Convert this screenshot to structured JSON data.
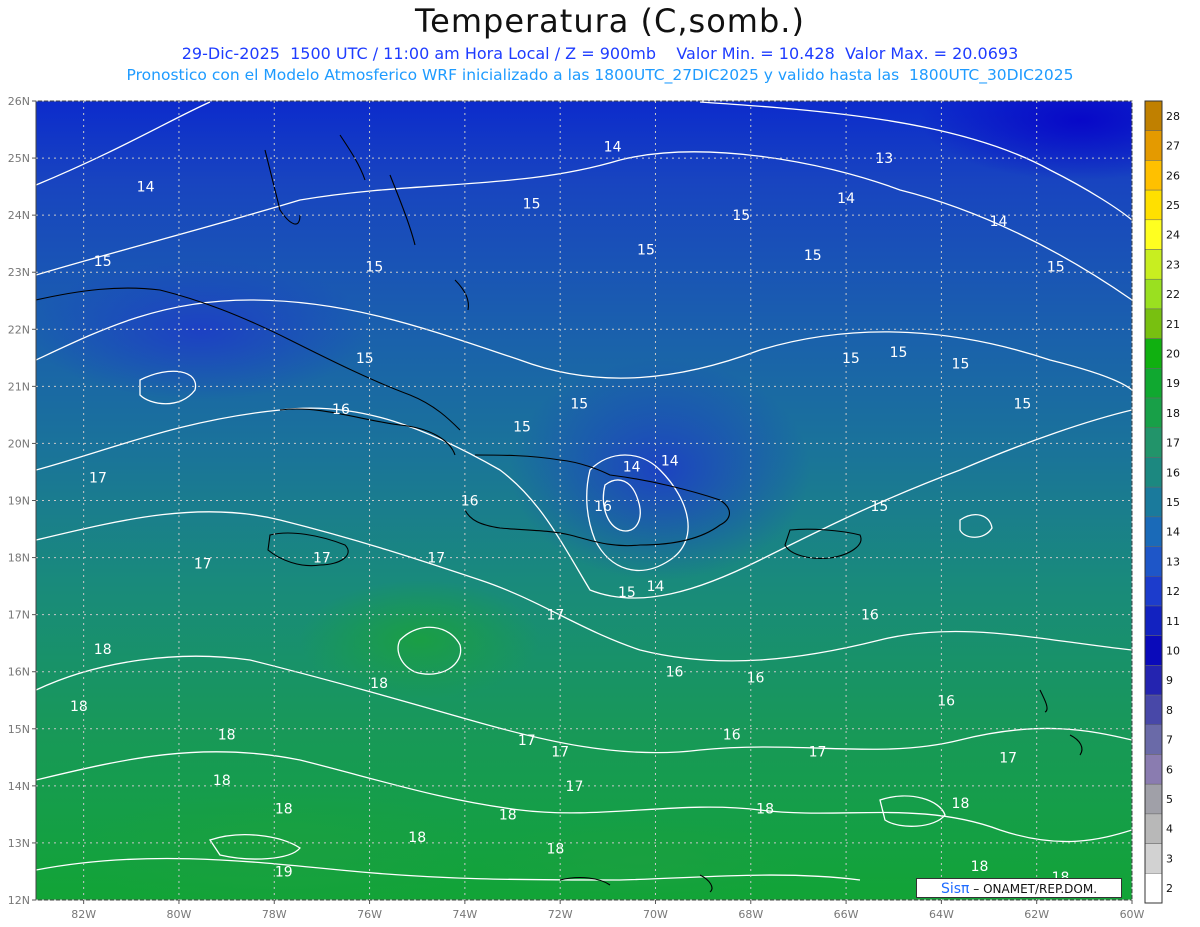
{
  "title": "Temperatura (C,somb.)",
  "subtitle_line1": "29-Dic-2025  1500 UTC / 11:00 am Hora Local / Z = 900mb    Valor Min. = 10.428  Valor Max. = 20.0693",
  "subtitle_line2": "Pronostico con el Modelo Atmosferico WRF inicializado a las 1800UTC_27DIC2025 y valido hasta las  1800UTC_30DIC2025",
  "credit": {
    "brand": "Sisπ",
    "text": "– ONAMET/REP.DOM."
  },
  "map": {
    "lon_range": [
      -83,
      -60
    ],
    "lat_range": [
      12,
      26
    ],
    "lon_ticks": [
      "82W",
      "80W",
      "78W",
      "76W",
      "74W",
      "72W",
      "70W",
      "68W",
      "66W",
      "64W",
      "62W",
      "60W"
    ],
    "lat_ticks": [
      "26N",
      "25N",
      "24N",
      "23N",
      "22N",
      "21N",
      "20N",
      "19N",
      "18N",
      "17N",
      "16N",
      "15N",
      "14N",
      "13N",
      "12N"
    ],
    "grid": true,
    "contour_labels": [
      {
        "text": "13",
        "lon": -65.2,
        "lat": 25.0
      },
      {
        "text": "14",
        "lon": -80.7,
        "lat": 24.5
      },
      {
        "text": "14",
        "lon": -70.9,
        "lat": 25.2
      },
      {
        "text": "14",
        "lon": -66.0,
        "lat": 24.3
      },
      {
        "text": "14",
        "lon": -62.8,
        "lat": 23.9
      },
      {
        "text": "15",
        "lon": -81.6,
        "lat": 23.2
      },
      {
        "text": "15",
        "lon": -72.6,
        "lat": 24.2
      },
      {
        "text": "15",
        "lon": -68.2,
        "lat": 24.0
      },
      {
        "text": "15",
        "lon": -70.2,
        "lat": 23.4
      },
      {
        "text": "15",
        "lon": -66.7,
        "lat": 23.3
      },
      {
        "text": "15",
        "lon": -75.9,
        "lat": 23.1
      },
      {
        "text": "15",
        "lon": -61.6,
        "lat": 23.1
      },
      {
        "text": "15",
        "lon": -76.1,
        "lat": 21.5
      },
      {
        "text": "15",
        "lon": -65.9,
        "lat": 21.5
      },
      {
        "text": "15",
        "lon": -64.9,
        "lat": 21.6
      },
      {
        "text": "15",
        "lon": -63.6,
        "lat": 21.4
      },
      {
        "text": "15",
        "lon": -62.3,
        "lat": 20.7
      },
      {
        "text": "15",
        "lon": -71.6,
        "lat": 20.7
      },
      {
        "text": "15",
        "lon": -72.8,
        "lat": 20.3
      },
      {
        "text": "16",
        "lon": -76.6,
        "lat": 20.6
      },
      {
        "text": "14",
        "lon": -70.5,
        "lat": 19.6
      },
      {
        "text": "14",
        "lon": -69.7,
        "lat": 19.7
      },
      {
        "text": "16",
        "lon": -73.9,
        "lat": 19.0
      },
      {
        "text": "16",
        "lon": -71.1,
        "lat": 18.9
      },
      {
        "text": "15",
        "lon": -65.3,
        "lat": 18.9
      },
      {
        "text": "17",
        "lon": -81.7,
        "lat": 19.4
      },
      {
        "text": "17",
        "lon": -79.5,
        "lat": 17.9
      },
      {
        "text": "17",
        "lon": -77.0,
        "lat": 18.0
      },
      {
        "text": "17",
        "lon": -74.6,
        "lat": 18.0
      },
      {
        "text": "15",
        "lon": -70.6,
        "lat": 17.4
      },
      {
        "text": "14",
        "lon": -70.0,
        "lat": 17.5
      },
      {
        "text": "17",
        "lon": -72.1,
        "lat": 17.0
      },
      {
        "text": "16",
        "lon": -65.5,
        "lat": 17.0
      },
      {
        "text": "18",
        "lon": -81.6,
        "lat": 16.4
      },
      {
        "text": "18",
        "lon": -75.8,
        "lat": 15.8
      },
      {
        "text": "16",
        "lon": -69.6,
        "lat": 16.0
      },
      {
        "text": "16",
        "lon": -67.9,
        "lat": 15.9
      },
      {
        "text": "16",
        "lon": -63.9,
        "lat": 15.5
      },
      {
        "text": "18",
        "lon": -82.1,
        "lat": 15.4
      },
      {
        "text": "18",
        "lon": -79.0,
        "lat": 14.9
      },
      {
        "text": "17",
        "lon": -72.7,
        "lat": 14.8
      },
      {
        "text": "17",
        "lon": -72.0,
        "lat": 14.6
      },
      {
        "text": "16",
        "lon": -68.4,
        "lat": 14.9
      },
      {
        "text": "17",
        "lon": -66.6,
        "lat": 14.6
      },
      {
        "text": "17",
        "lon": -62.6,
        "lat": 14.5
      },
      {
        "text": "18",
        "lon": -79.1,
        "lat": 14.1
      },
      {
        "text": "18",
        "lon": -77.8,
        "lat": 13.6
      },
      {
        "text": "17",
        "lon": -71.7,
        "lat": 14.0
      },
      {
        "text": "18",
        "lon": -73.1,
        "lat": 13.5
      },
      {
        "text": "18",
        "lon": -67.7,
        "lat": 13.6
      },
      {
        "text": "18",
        "lon": -63.6,
        "lat": 13.7
      },
      {
        "text": "18",
        "lon": -75.0,
        "lat": 13.1
      },
      {
        "text": "18",
        "lon": -72.1,
        "lat": 12.9
      },
      {
        "text": "18",
        "lon": -63.2,
        "lat": 12.6
      },
      {
        "text": "18",
        "lon": -61.5,
        "lat": 12.4
      },
      {
        "text": "19",
        "lon": -77.8,
        "lat": 12.5
      }
    ]
  },
  "colorbar": {
    "labels": [
      "28",
      "27",
      "26",
      "25",
      "24",
      "23",
      "22",
      "21",
      "20",
      "19",
      "18",
      "17",
      "16",
      "15",
      "14",
      "13",
      "12",
      "11",
      "10",
      "9",
      "8",
      "7",
      "6",
      "5",
      "4",
      "3",
      "2"
    ],
    "colors": [
      "#c08000",
      "#e49a00",
      "#ffc000",
      "#ffe000",
      "#ffff20",
      "#c8ee20",
      "#9ae020",
      "#78c010",
      "#10b010",
      "#10a830",
      "#18a048",
      "#22946a",
      "#1c8880",
      "#1a7a9c",
      "#1a6ab8",
      "#1e56c8",
      "#1c3ccc",
      "#1222c0",
      "#0a0aba",
      "#2424b0",
      "#4848a8",
      "#6a6aa8",
      "#8a7cb0",
      "#a0a0a8",
      "#b8b8b8",
      "#d2d2d2",
      "#ffffff"
    ]
  }
}
